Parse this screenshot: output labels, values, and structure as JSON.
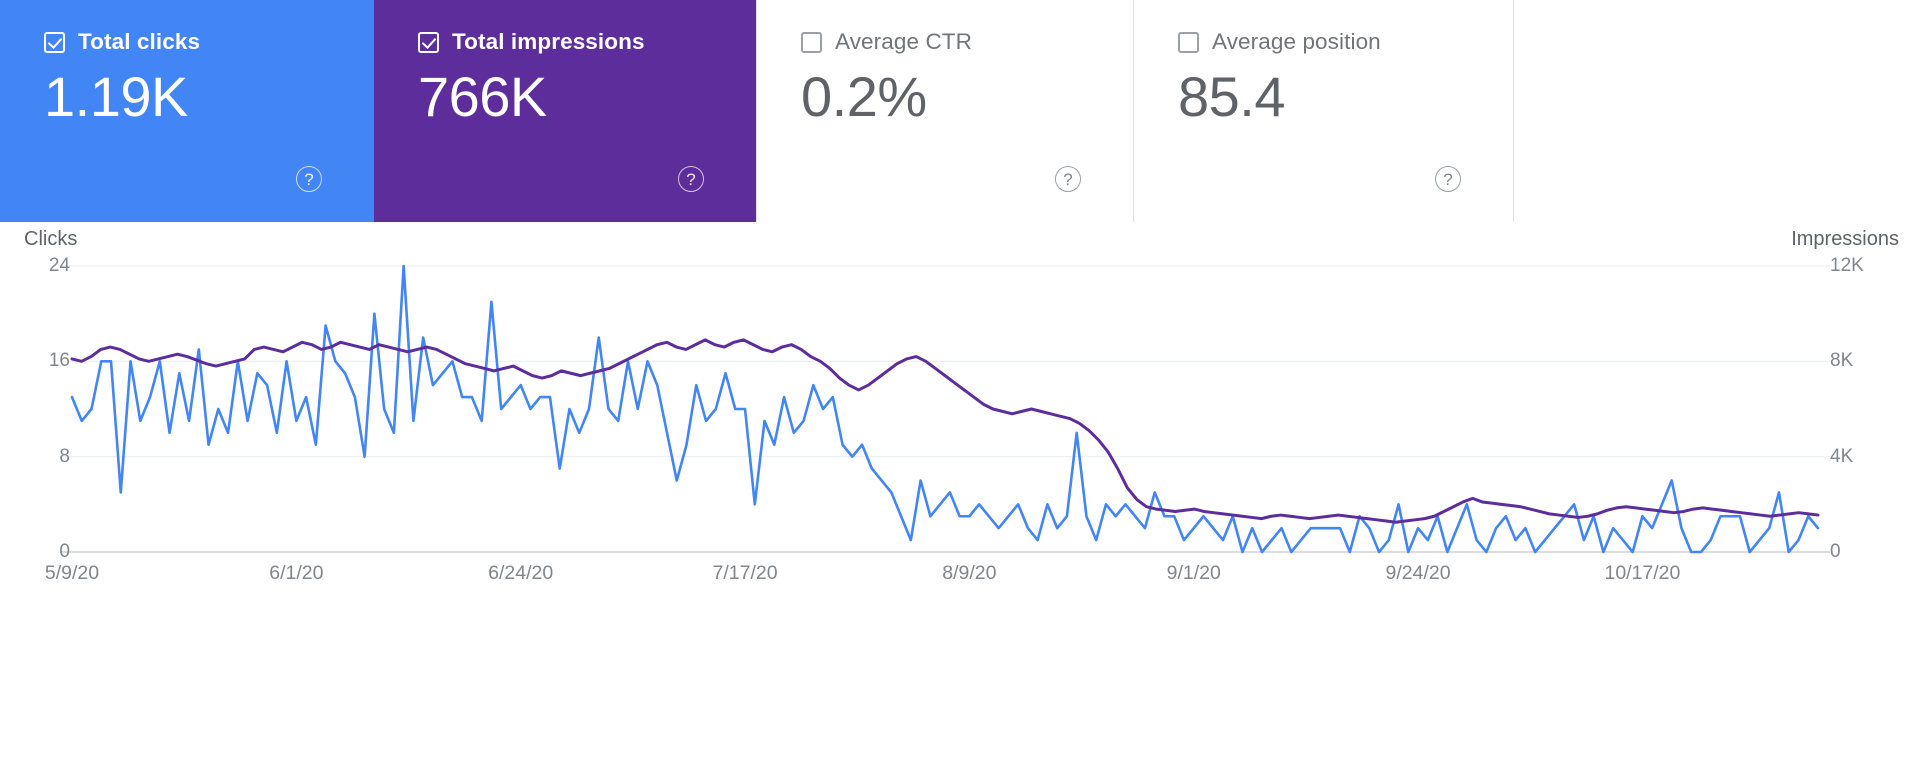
{
  "metric_cards": [
    {
      "label": "Total clicks",
      "value": "1.19K",
      "checked": true,
      "color": "#4285f4",
      "help_icon": "help-circle-icon"
    },
    {
      "label": "Total impressions",
      "value": "766K",
      "checked": true,
      "color": "#5c2d9b",
      "help_icon": "help-circle-icon"
    },
    {
      "label": "Average CTR",
      "value": "0.2%",
      "checked": false,
      "color": "#ffffff",
      "help_icon": "help-circle-icon"
    },
    {
      "label": "Average position",
      "value": "85.4",
      "checked": false,
      "color": "#ffffff",
      "help_icon": "help-circle-icon"
    }
  ],
  "chart_data": {
    "type": "line",
    "title": "",
    "xlabel": "",
    "ylabel": "Clicks",
    "y2label": "Impressions",
    "grid": true,
    "legend_position": "none",
    "left_axis": {
      "name": "Clicks",
      "ticks": [
        "0",
        "8",
        "16",
        "24"
      ],
      "tick_values": [
        0,
        8,
        16,
        24
      ],
      "ylim": [
        0,
        24
      ],
      "color": "#4285f4"
    },
    "right_axis": {
      "name": "Impressions",
      "ticks": [
        "0",
        "4K",
        "8K",
        "12K"
      ],
      "tick_values": [
        0,
        4000,
        8000,
        12000
      ],
      "ylim": [
        0,
        12000
      ],
      "color": "#5c2d9b"
    },
    "x_ticks": [
      "5/9/20",
      "6/1/20",
      "6/24/20",
      "7/17/20",
      "8/9/20",
      "9/1/20",
      "9/24/20",
      "10/17/20"
    ],
    "x_tick_indices": [
      0,
      23,
      46,
      69,
      92,
      115,
      138,
      161
    ],
    "n_points": 180,
    "series": [
      {
        "name": "Clicks",
        "color": "#4285f4",
        "axis": "left",
        "values": [
          13,
          11,
          12,
          16,
          16,
          5,
          16,
          11,
          13,
          16,
          10,
          15,
          11,
          17,
          9,
          12,
          10,
          16,
          11,
          15,
          14,
          10,
          16,
          11,
          13,
          9,
          19,
          16,
          15,
          13,
          8,
          20,
          12,
          10,
          24,
          11,
          18,
          14,
          15,
          16,
          13,
          13,
          11,
          21,
          12,
          13,
          14,
          12,
          13,
          13,
          7,
          12,
          10,
          12,
          18,
          12,
          11,
          16,
          12,
          16,
          14,
          10,
          6,
          9,
          14,
          11,
          12,
          15,
          12,
          12,
          4,
          11,
          9,
          13,
          10,
          11,
          14,
          12,
          13,
          9,
          8,
          9,
          7,
          6,
          5,
          3,
          1,
          6,
          3,
          4,
          5,
          3,
          3,
          4,
          3,
          2,
          3,
          4,
          2,
          1,
          4,
          2,
          3,
          10,
          3,
          1,
          4,
          3,
          4,
          3,
          2,
          5,
          3,
          3,
          1,
          2,
          3,
          2,
          1,
          3,
          0,
          2,
          0,
          1,
          2,
          0,
          1,
          2,
          2,
          2,
          2,
          0,
          3,
          2,
          0,
          1,
          4,
          0,
          2,
          1,
          3,
          0,
          2,
          4,
          1,
          0,
          2,
          3,
          1,
          2,
          0,
          1,
          2,
          3,
          4,
          1,
          3,
          0,
          2,
          1,
          0,
          3,
          2,
          4,
          6,
          2,
          0,
          0,
          1,
          3,
          3,
          3,
          0,
          1,
          2,
          5,
          0,
          1,
          3,
          2
        ]
      },
      {
        "name": "Impressions",
        "color": "#5c2d9b",
        "axis": "right",
        "values": [
          8100,
          8000,
          8200,
          8500,
          8600,
          8500,
          8300,
          8100,
          8000,
          8100,
          8200,
          8300,
          8200,
          8050,
          7900,
          7800,
          7900,
          8000,
          8100,
          8500,
          8600,
          8500,
          8400,
          8600,
          8800,
          8700,
          8500,
          8600,
          8800,
          8700,
          8600,
          8500,
          8700,
          8600,
          8500,
          8400,
          8500,
          8600,
          8500,
          8300,
          8100,
          7900,
          7800,
          7700,
          7600,
          7700,
          7800,
          7600,
          7400,
          7300,
          7400,
          7600,
          7500,
          7400,
          7500,
          7600,
          7700,
          7900,
          8100,
          8300,
          8500,
          8700,
          8800,
          8600,
          8500,
          8700,
          8900,
          8700,
          8600,
          8800,
          8900,
          8700,
          8500,
          8400,
          8600,
          8700,
          8500,
          8200,
          8000,
          7700,
          7300,
          7000,
          6800,
          7000,
          7300,
          7600,
          7900,
          8100,
          8200,
          8000,
          7700,
          7400,
          7100,
          6800,
          6500,
          6200,
          6000,
          5900,
          5800,
          5900,
          6000,
          5900,
          5800,
          5700,
          5600,
          5400,
          5100,
          4700,
          4200,
          3500,
          2700,
          2200,
          1900,
          1800,
          1750,
          1700,
          1750,
          1800,
          1700,
          1650,
          1600,
          1550,
          1500,
          1450,
          1400,
          1500,
          1550,
          1500,
          1450,
          1400,
          1450,
          1500,
          1550,
          1500,
          1450,
          1400,
          1350,
          1300,
          1250,
          1300,
          1350,
          1400,
          1500,
          1700,
          1900,
          2100,
          2250,
          2100,
          2050,
          2000,
          1950,
          1900,
          1800,
          1700,
          1600,
          1550,
          1500,
          1450,
          1500,
          1600,
          1750,
          1850,
          1900,
          1850,
          1800,
          1750,
          1700,
          1650,
          1700,
          1800,
          1850,
          1800,
          1750,
          1700,
          1650,
          1600,
          1550,
          1500,
          1550,
          1600,
          1650,
          1600,
          1550
        ]
      }
    ]
  }
}
